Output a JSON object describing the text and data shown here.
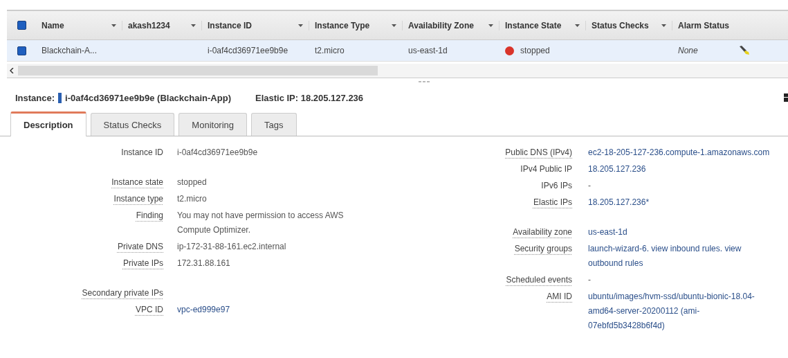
{
  "table": {
    "header_checkbox": {
      "checked": true
    },
    "columns": [
      {
        "label": "Name",
        "menu": true
      },
      {
        "label": "akash1234",
        "menu": true
      },
      {
        "label": "Instance ID",
        "menu": true
      },
      {
        "label": "Instance Type",
        "menu": true
      },
      {
        "label": "Availability Zone",
        "menu": true
      },
      {
        "label": "Instance State",
        "menu": true
      },
      {
        "label": "Status Checks",
        "menu": true
      },
      {
        "label": "Alarm Status",
        "menu": false
      }
    ],
    "rows": [
      {
        "selected": true,
        "checked": true,
        "cells": [
          {
            "kind": "text",
            "text": "Blackchain-A..."
          },
          {
            "kind": "empty"
          },
          {
            "kind": "text",
            "text": "i-0af4cd36971ee9b9e"
          },
          {
            "kind": "text",
            "text": "t2.micro"
          },
          {
            "kind": "text",
            "text": "us-east-1d"
          },
          {
            "kind": "status",
            "text": "stopped",
            "color": "#d9342b"
          },
          {
            "kind": "empty"
          },
          {
            "kind": "alarm",
            "text": "None"
          }
        ]
      }
    ]
  },
  "instance_bar": {
    "label": "Instance:",
    "instance": "i-0af4cd36971ee9b9e (Blackchain-App)",
    "elastic_ip": "Elastic IP: 18.205.127.236"
  },
  "tabs": [
    {
      "label": "Description",
      "selected": true
    },
    {
      "label": "Status Checks",
      "selected": false
    },
    {
      "label": "Monitoring",
      "selected": false
    },
    {
      "label": "Tags",
      "selected": false
    }
  ],
  "details": {
    "left": [
      [
        {
          "label": "Instance ID",
          "help": false,
          "kind": "text",
          "value": "i-0af4cd36971ee9b9e"
        }
      ],
      [
        {
          "label": "Instance state",
          "help": true,
          "kind": "text",
          "value": "stopped"
        },
        {
          "label": "Instance type",
          "help": true,
          "kind": "text",
          "value": "t2.micro"
        },
        {
          "label": "Finding",
          "help": true,
          "kind": "text",
          "value": "You may not have permission to access AWS Compute Optimizer."
        },
        {
          "label": "Private DNS",
          "help": true,
          "kind": "text",
          "value": "ip-172-31-88-161.ec2.internal"
        },
        {
          "label": "Private IPs",
          "help": true,
          "kind": "text",
          "value": "172.31.88.161"
        }
      ],
      [
        {
          "label": "Secondary private IPs",
          "help": true,
          "kind": "none"
        },
        {
          "label": "VPC ID",
          "help": true,
          "kind": "link",
          "value": "vpc-ed999e97"
        }
      ]
    ],
    "right": [
      [
        {
          "label": "Public DNS (IPv4)",
          "help": true,
          "kind": "link",
          "value": "ec2-18-205-127-236.compute-1.amazonaws.com"
        },
        {
          "label": "IPv4 Public IP",
          "help": false,
          "kind": "link",
          "value": "18.205.127.236"
        },
        {
          "label": "IPv6 IPs",
          "help": false,
          "kind": "text",
          "value": "-"
        },
        {
          "label": "Elastic IPs",
          "help": true,
          "kind": "link",
          "value": "18.205.127.236*"
        }
      ],
      [
        {
          "label": "Availability zone",
          "help": true,
          "kind": "link",
          "value": "us-east-1d"
        },
        {
          "label": "Security groups",
          "help": true,
          "kind": "link",
          "value": "launch-wizard-6. view inbound rules. view outbound rules"
        },
        {
          "label": "Scheduled events",
          "help": true,
          "kind": "text",
          "value": "-"
        },
        {
          "label": "AMI ID",
          "help": true,
          "kind": "link",
          "value": "ubuntu/images/hvm-ssd/ubuntu-bionic-18.04-amd64-server-20200112 (ami-07ebfd5b3428b6f4d)"
        }
      ]
    ]
  }
}
